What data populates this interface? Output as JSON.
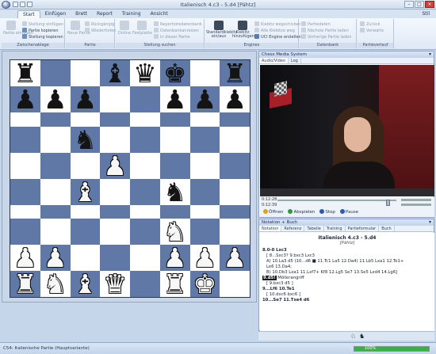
{
  "window": {
    "title": "Italienisch 4.c3 - 5.d4 [Pähtz]",
    "controls": [
      "–",
      "□",
      "×"
    ]
  },
  "tabs": [
    "Start",
    "Einfügen",
    "Brett",
    "Report",
    "Training",
    "Ansicht"
  ],
  "active_tab": "Start",
  "tabrow_right": "Stil",
  "ribbon": {
    "groups": [
      {
        "label": "Zwischenablage",
        "items": [
          {
            "label": "Partie einfügen",
            "type": "large",
            "enabled": false
          },
          {
            "label": "Stellung einfügen",
            "enabled": false
          },
          {
            "label": "Partie kopieren",
            "enabled": true
          },
          {
            "label": "Stellung kopieren",
            "enabled": true
          }
        ]
      },
      {
        "label": "Partie",
        "items": [
          {
            "label": "Neue Partie",
            "type": "large",
            "enabled": false
          },
          {
            "label": "Rückgängig",
            "enabled": false
          },
          {
            "label": "Wiederholen",
            "enabled": false
          }
        ]
      },
      {
        "label": "Stellung suchen",
        "items": [
          {
            "label": "Online",
            "type": "large",
            "enabled": false
          },
          {
            "label": "Festplatte",
            "type": "large",
            "enabled": false
          },
          {
            "label": "Repertoiredatenbank",
            "enabled": false
          },
          {
            "label": "Datenbankanreizen",
            "enabled": false
          },
          {
            "label": "In dieser Partie",
            "enabled": false
          }
        ]
      },
      {
        "label": "Engines",
        "items": [
          {
            "label": "Standardkiebitz ein/aus",
            "type": "large",
            "enabled": true
          },
          {
            "label": "Kiebitz hinzufügen",
            "type": "large",
            "enabled": true
          },
          {
            "label": "Kiebitz wegschicken",
            "enabled": false
          },
          {
            "label": "Alle Kiebitze weg",
            "enabled": false
          },
          {
            "label": "UCI Engine erstellen",
            "enabled": true
          }
        ]
      },
      {
        "label": "Datenbank",
        "items": [
          {
            "label": "Partiedaten",
            "enabled": false
          },
          {
            "label": "Nächste Partie laden",
            "enabled": false
          },
          {
            "label": "Vorherige Partie laden",
            "enabled": false
          }
        ]
      },
      {
        "label": "Partieverlauf",
        "items": [
          {
            "label": "Zurück",
            "enabled": false
          },
          {
            "label": "Vorwärts",
            "enabled": false
          }
        ]
      }
    ]
  },
  "board": {
    "rows": [
      [
        "bR",
        "",
        "",
        "bB",
        "bQ",
        "bK",
        "",
        "bR"
      ],
      [
        "bP",
        "bP",
        "bP",
        "",
        "",
        "bP",
        "bP",
        "bP"
      ],
      [
        "",
        "",
        "",
        "",
        "",
        "",
        "",
        ""
      ],
      [
        "",
        "",
        "bN",
        "",
        "",
        "",
        "",
        ""
      ],
      [
        "",
        "",
        "",
        "wP",
        "",
        "",
        "",
        ""
      ],
      [
        "",
        "",
        "wB",
        "",
        "",
        "bN",
        "",
        ""
      ],
      [
        "",
        "",
        "",
        "",
        "",
        "",
        "",
        ""
      ],
      [
        "",
        "",
        "",
        "",
        "",
        "wN",
        "",
        ""
      ]
    ],
    "rows_bottom": [
      [
        "wP",
        "wP",
        "",
        "",
        "",
        "wP",
        "wP",
        "wP"
      ],
      [
        "wR",
        "wN",
        "wB",
        "wQ",
        "",
        "wR",
        "wK",
        ""
      ]
    ]
  },
  "media": {
    "pane_title": "Chess Media System",
    "tabs": [
      "Audio/Video",
      "Log"
    ],
    "time_elapsed": "0:12:28",
    "time_total": "0:12:39",
    "seek_fraction": 0.95,
    "controls": [
      {
        "label": "Öffnen",
        "color": "#e0a020"
      },
      {
        "label": "Abspielen",
        "color": "#2f9a3c"
      },
      {
        "label": "Stop",
        "color": "#2a58b8"
      },
      {
        "label": "Pause",
        "color": "#2a58b8"
      }
    ]
  },
  "notation": {
    "pane_title": "Notation + Buch",
    "tabs": [
      "Notation",
      "Referenz",
      "Tabelle",
      "Training",
      "Partieformular",
      "Buch"
    ],
    "heading": "Italienisch 4.c3 - 5.d4",
    "subheading": "[Pähtz]",
    "lines": [
      {
        "text": "8.0-0 Lxc3",
        "style": "b"
      },
      {
        "text": "[ 8...Sxc3? 9.bxc3 Lxc3",
        "style": "ind"
      },
      {
        "text": "A) 10.La3 d5 (10...d6 ■ 11.Tc1 La5 12.Da4) 11.Lb5 Lxa1 12.Te1+",
        "style": "ind"
      },
      {
        "text": "Le6 13.Da4;",
        "style": "ind"
      },
      {
        "text": "B) 10.Db3 Lxa1 11.Lxf7+ Kf8 12.Lg5 Se7 13.Se5 Lxd4 14.Lg6]",
        "style": "ind"
      },
      {
        "text": "9.d5!",
        "style": "hl",
        "suffix": " Möllerangriff"
      },
      {
        "text": "[ 9.bxc3 d5 ]",
        "style": "ind"
      },
      {
        "text": "9...Lf6 10.Te1",
        "style": "b"
      },
      {
        "text": "[ 10.dxc6 bxc6 ]",
        "style": "ind"
      },
      {
        "text": "10...Se7 11.Txe4 d6",
        "style": "b"
      }
    ]
  },
  "status": {
    "text": "C54: Italienische Partie (Hauptvariante)",
    "progress_percent": "100%",
    "progress_fraction": 1.0
  }
}
